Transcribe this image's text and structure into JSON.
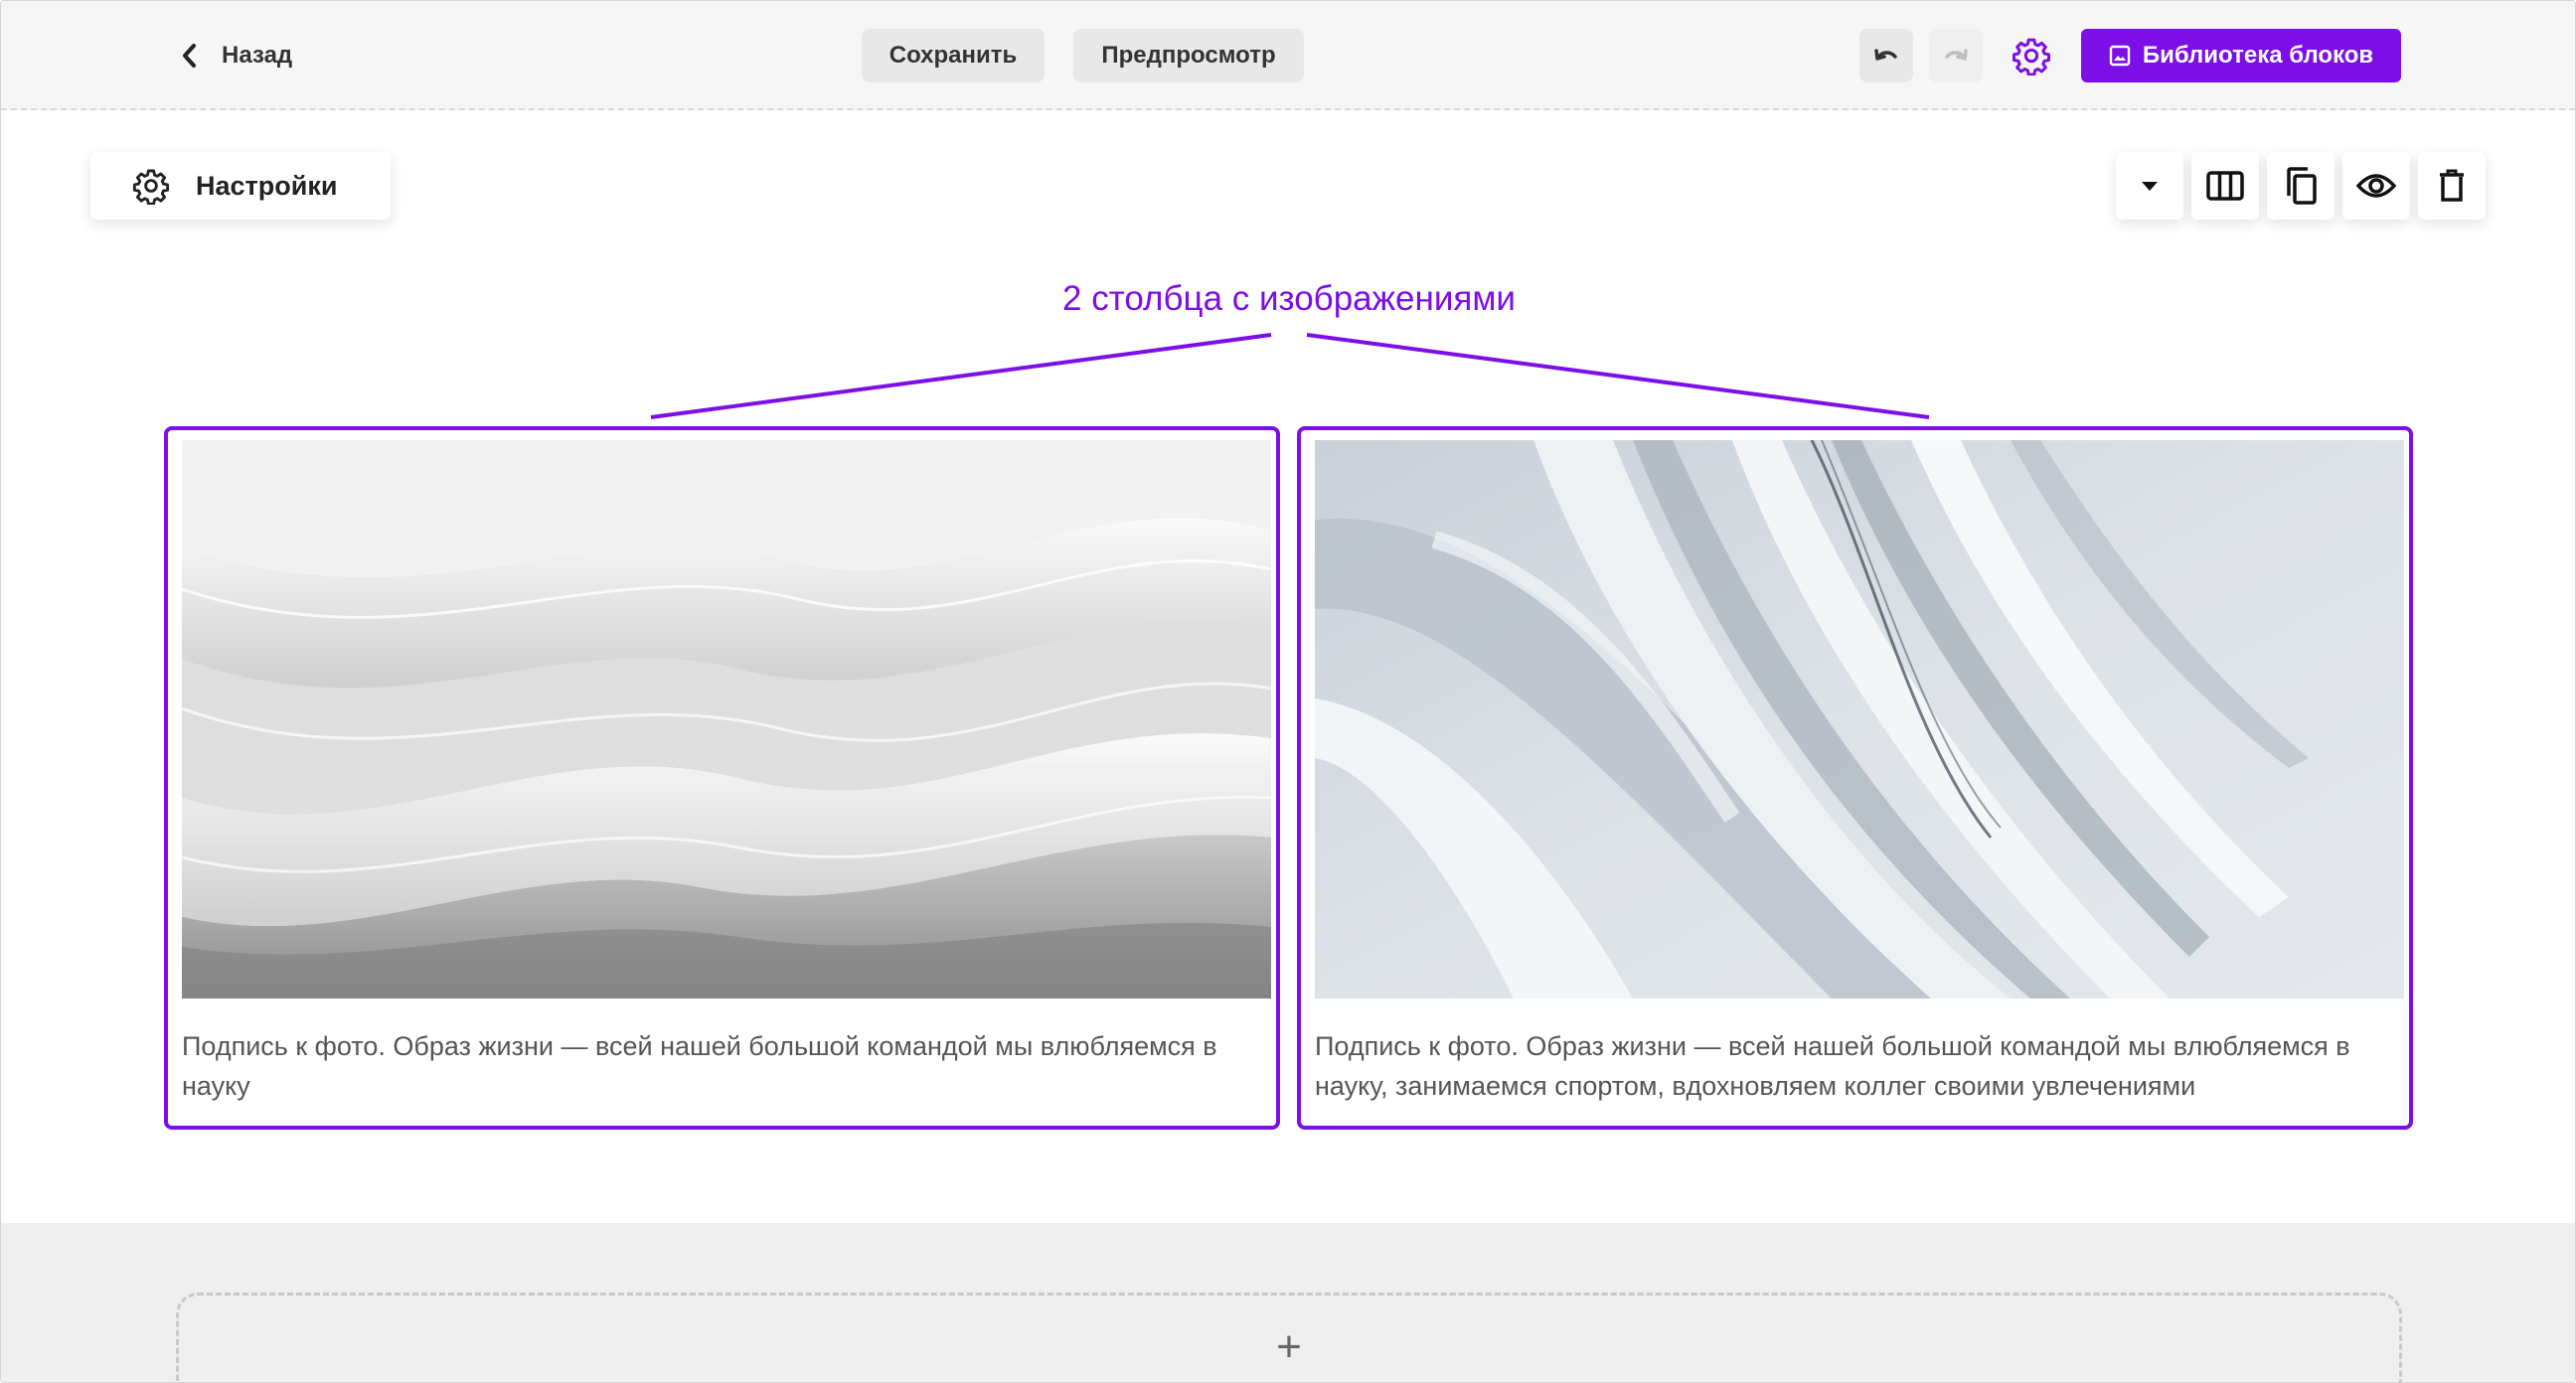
{
  "header": {
    "back_label": "Назад",
    "save_label": "Сохранить",
    "preview_label": "Предпросмотр",
    "library_label": "Библиотека блоков"
  },
  "settings": {
    "label": "Настройки"
  },
  "annotation": {
    "text": "2 столбца с изображениями"
  },
  "columns": [
    {
      "caption": "Подпись к фото. Образ жизни — всей нашей большой командой мы влюбляемся в науку"
    },
    {
      "caption": "Подпись к фото. Образ жизни — всей нашей большой командой мы влюбляемся в науку, занимаемся спортом, вдохновляем коллег своими увлечениями"
    }
  ],
  "dropzone": {
    "plus": "+"
  },
  "colors": {
    "accent": "#7c0ee8",
    "header_bg": "#f6f6f6",
    "bottom_bg": "#efefef"
  },
  "icons": [
    "chevron-left-icon",
    "undo-icon",
    "redo-icon",
    "gear-icon",
    "library-icon",
    "caret-down-icon",
    "columns-icon",
    "copy-icon",
    "eye-icon",
    "trash-icon"
  ]
}
